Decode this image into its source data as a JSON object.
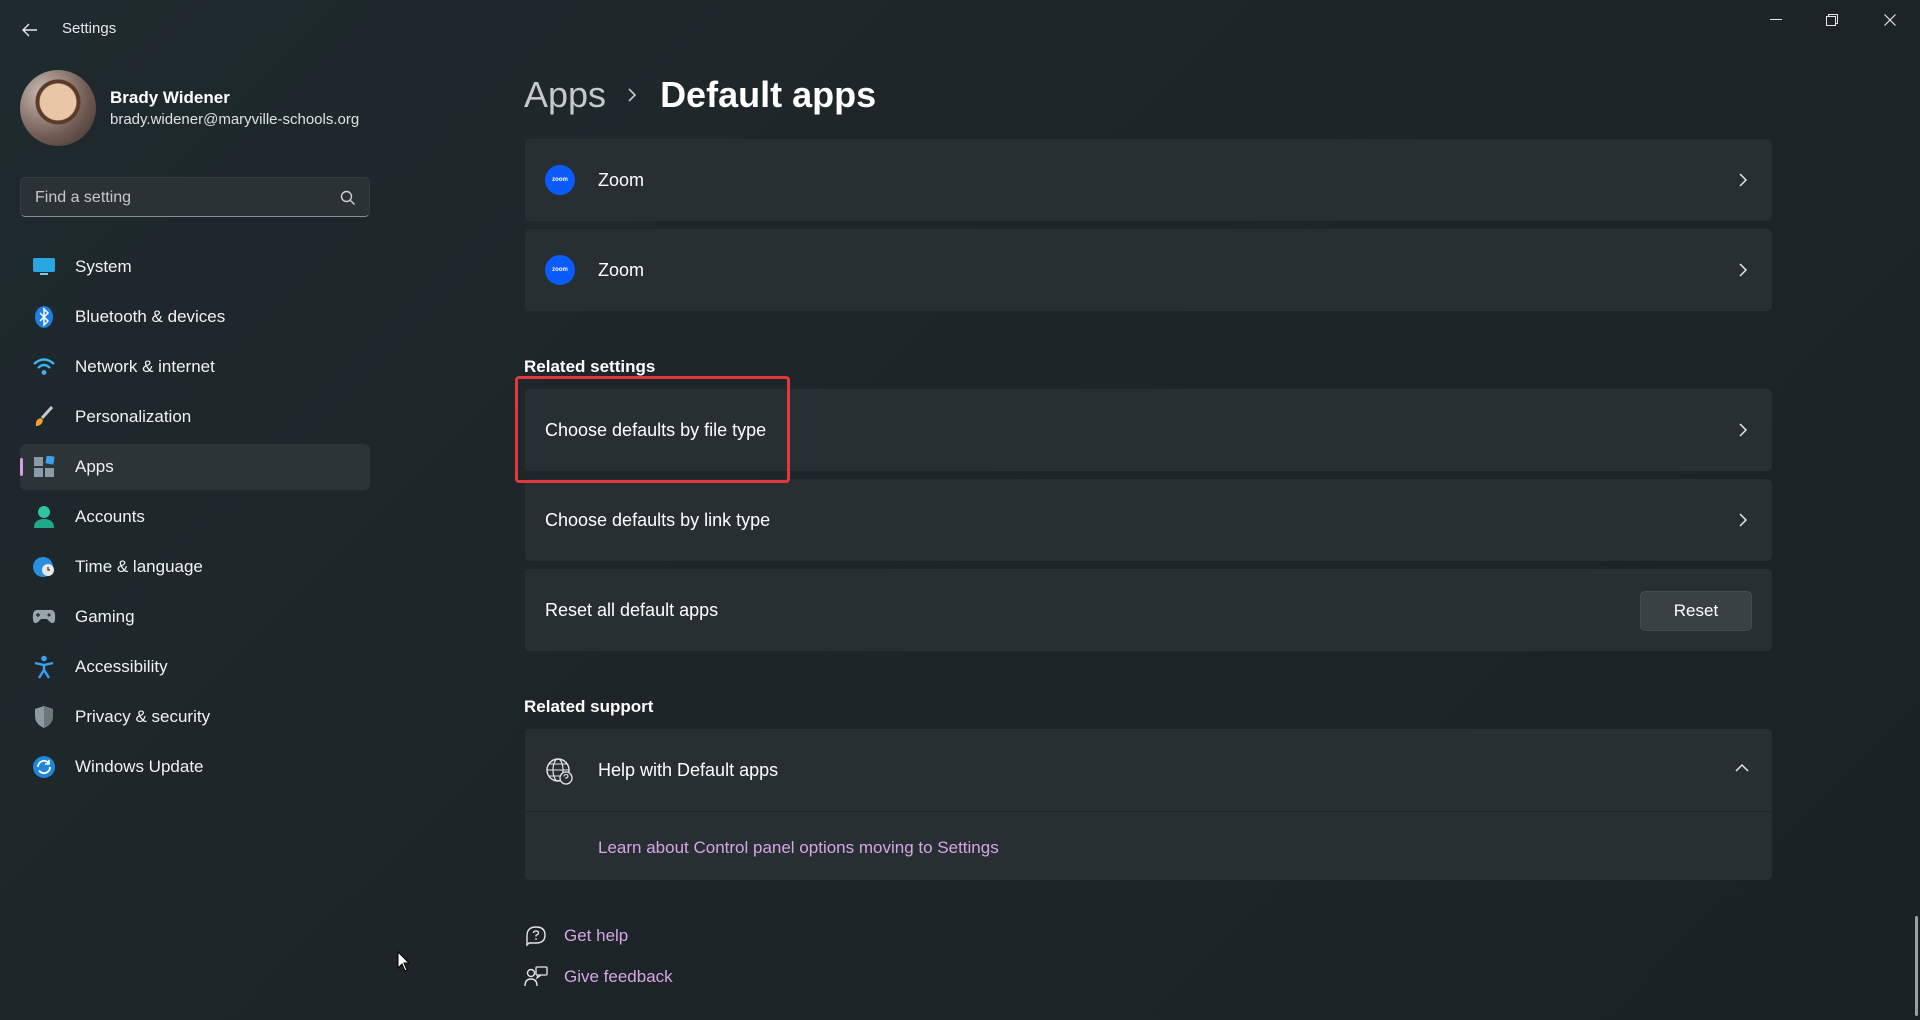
{
  "window": {
    "title": "Settings",
    "minimize_icon": "minimize-icon",
    "restore_icon": "restore-icon",
    "close_icon": "close-icon"
  },
  "profile": {
    "name": "Brady Widener",
    "email": "brady.widener@maryville-schools.org"
  },
  "search": {
    "placeholder": "Find a setting"
  },
  "sidebar": {
    "items": [
      {
        "label": "System",
        "icon": "system-icon"
      },
      {
        "label": "Bluetooth & devices",
        "icon": "bluetooth-icon"
      },
      {
        "label": "Network & internet",
        "icon": "wifi-icon"
      },
      {
        "label": "Personalization",
        "icon": "brush-icon"
      },
      {
        "label": "Apps",
        "icon": "apps-icon",
        "selected": true
      },
      {
        "label": "Accounts",
        "icon": "account-icon"
      },
      {
        "label": "Time & language",
        "icon": "clock-globe-icon"
      },
      {
        "label": "Gaming",
        "icon": "gamepad-icon"
      },
      {
        "label": "Accessibility",
        "icon": "accessibility-icon"
      },
      {
        "label": "Privacy & security",
        "icon": "shield-icon"
      },
      {
        "label": "Windows Update",
        "icon": "update-icon"
      }
    ]
  },
  "breadcrumb": {
    "parent": "Apps",
    "current": "Default apps"
  },
  "apps": [
    {
      "label": "Zoom",
      "icon_text": "zoom"
    },
    {
      "label": "Zoom",
      "icon_text": "zoom"
    }
  ],
  "related_settings": {
    "title": "Related settings",
    "file_type": "Choose defaults by file type",
    "link_type": "Choose defaults by link type",
    "reset_all": "Reset all default apps",
    "reset_button": "Reset"
  },
  "related_support": {
    "title": "Related support",
    "help_label": "Help with Default apps",
    "help_link": "Learn about Control panel options moving to Settings"
  },
  "footer": {
    "get_help": "Get help",
    "give_feedback": "Give feedback"
  },
  "colors": {
    "accent": "#d89ce0",
    "link": "#d6a5e6",
    "highlight": "#e0383e",
    "zoom_blue": "#0b5cff"
  }
}
